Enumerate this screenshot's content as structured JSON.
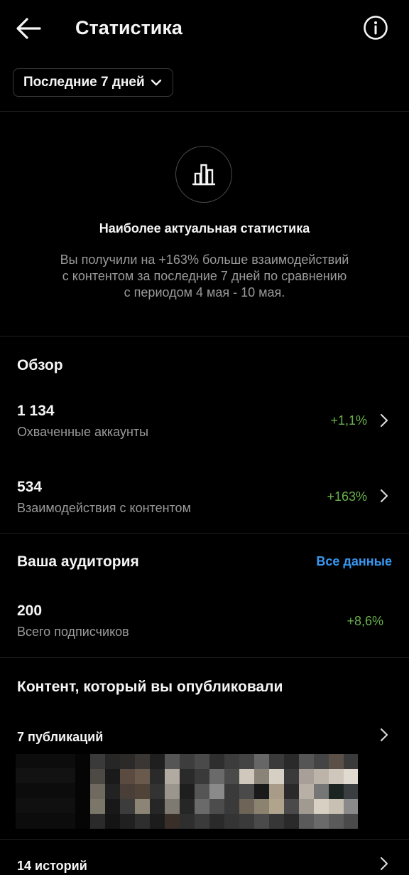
{
  "header": {
    "title": "Статистика"
  },
  "period": {
    "label": "Последние 7 дней"
  },
  "hero": {
    "title": "Наиболее актуальная статистика",
    "line1": "Вы получили на +163% больше взаимодействий",
    "line2": "с контентом за последние 7 дней по сравнению",
    "line3": "с периодом 4 мая - 10 мая."
  },
  "overview": {
    "title": "Обзор",
    "metrics": [
      {
        "value": "1 134",
        "label": "Охваченные аккаунты",
        "change": "+1,1%"
      },
      {
        "value": "534",
        "label": "Взаимодействия с контентом",
        "change": "+163%"
      }
    ]
  },
  "audience": {
    "title": "Ваша аудитория",
    "link": "Все данные",
    "value": "200",
    "label": "Всего подписчиков",
    "change": "+8,6%"
  },
  "content": {
    "title": "Контент, который вы опубликовали",
    "posts": "7 публикаций",
    "stories": "14 историй"
  },
  "colors": {
    "positive": "#6ab04c",
    "link": "#3897f0",
    "background": "#000000"
  }
}
